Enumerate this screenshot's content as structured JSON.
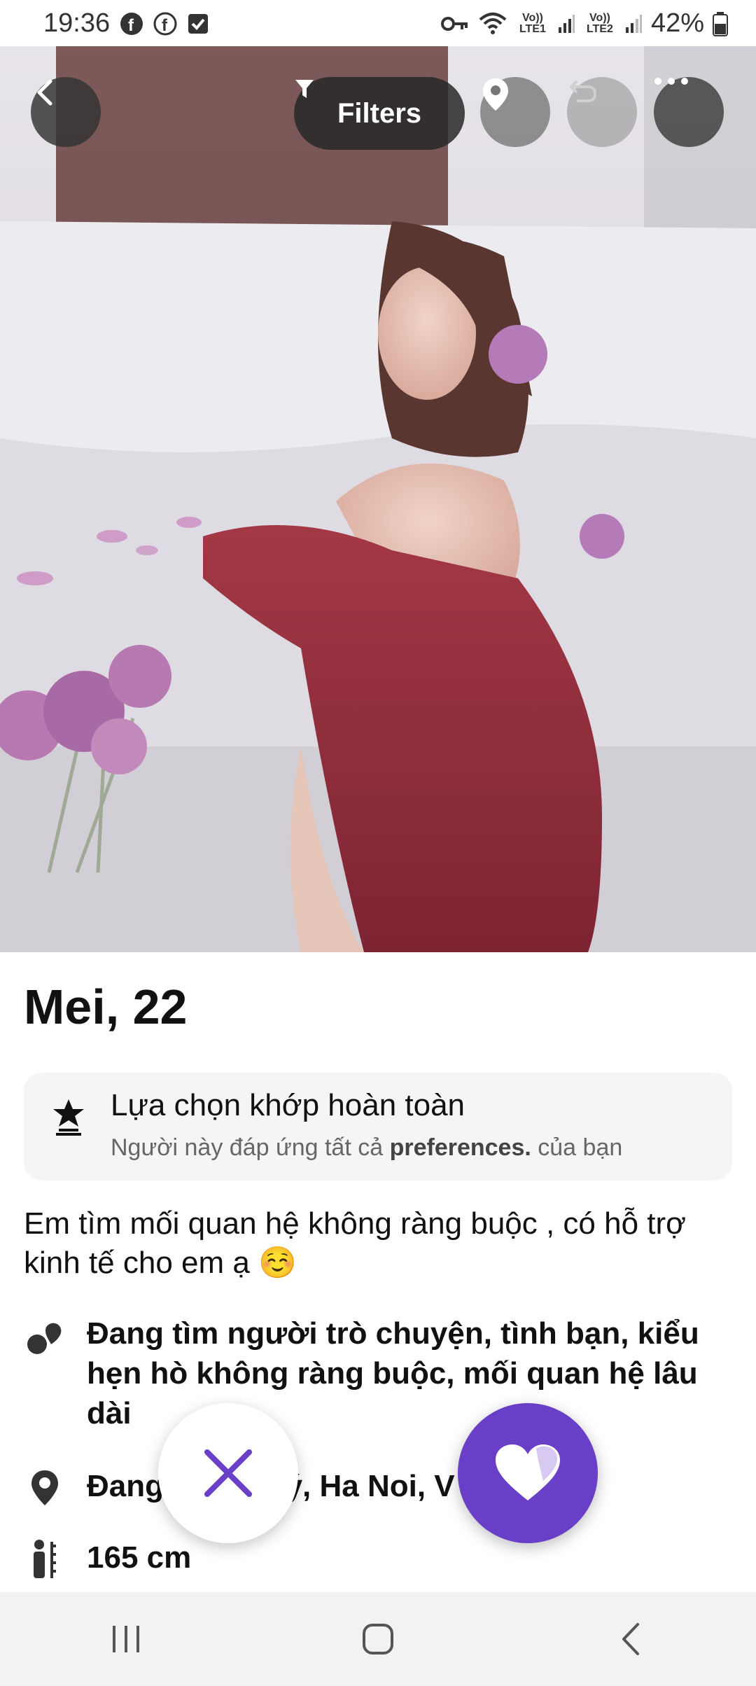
{
  "status_bar": {
    "time": "19:36",
    "battery": "42%",
    "sim1": "Vo)) LTE1",
    "sim2": "Vo)) LTE2"
  },
  "top_bar": {
    "filters_label": "Filters"
  },
  "profile": {
    "name_age": "Mei, 22",
    "match_title": "Lựa chọn khớp hoàn toàn",
    "match_sub_prefix": "Người này đáp ứng tất cả ",
    "match_sub_bold": "preferences.",
    "match_sub_suffix": " của bạn",
    "bio": "Em tìm mối quan hệ không ràng buộc , có hỗ trợ kinh tế cho em ạ ☺️",
    "looking_for": "Đang tìm người trò chuyện, tình bạn, kiểu hẹn hò không ràng buộc, mối quan hệ lâu dài",
    "location_visible": "Đang            Lý, Ha Noi, V",
    "height": "165 cm"
  },
  "colors": {
    "accent": "#6a3fc8",
    "dark_button": "#323232"
  },
  "icons": [
    "back-icon",
    "filter-icon",
    "location-pin-icon",
    "undo-icon",
    "more-icon",
    "star-badge-icon",
    "hearts-icon",
    "location-icon",
    "height-icon",
    "close-icon",
    "heart-icon",
    "recents-icon",
    "home-icon",
    "nav-back-icon"
  ]
}
